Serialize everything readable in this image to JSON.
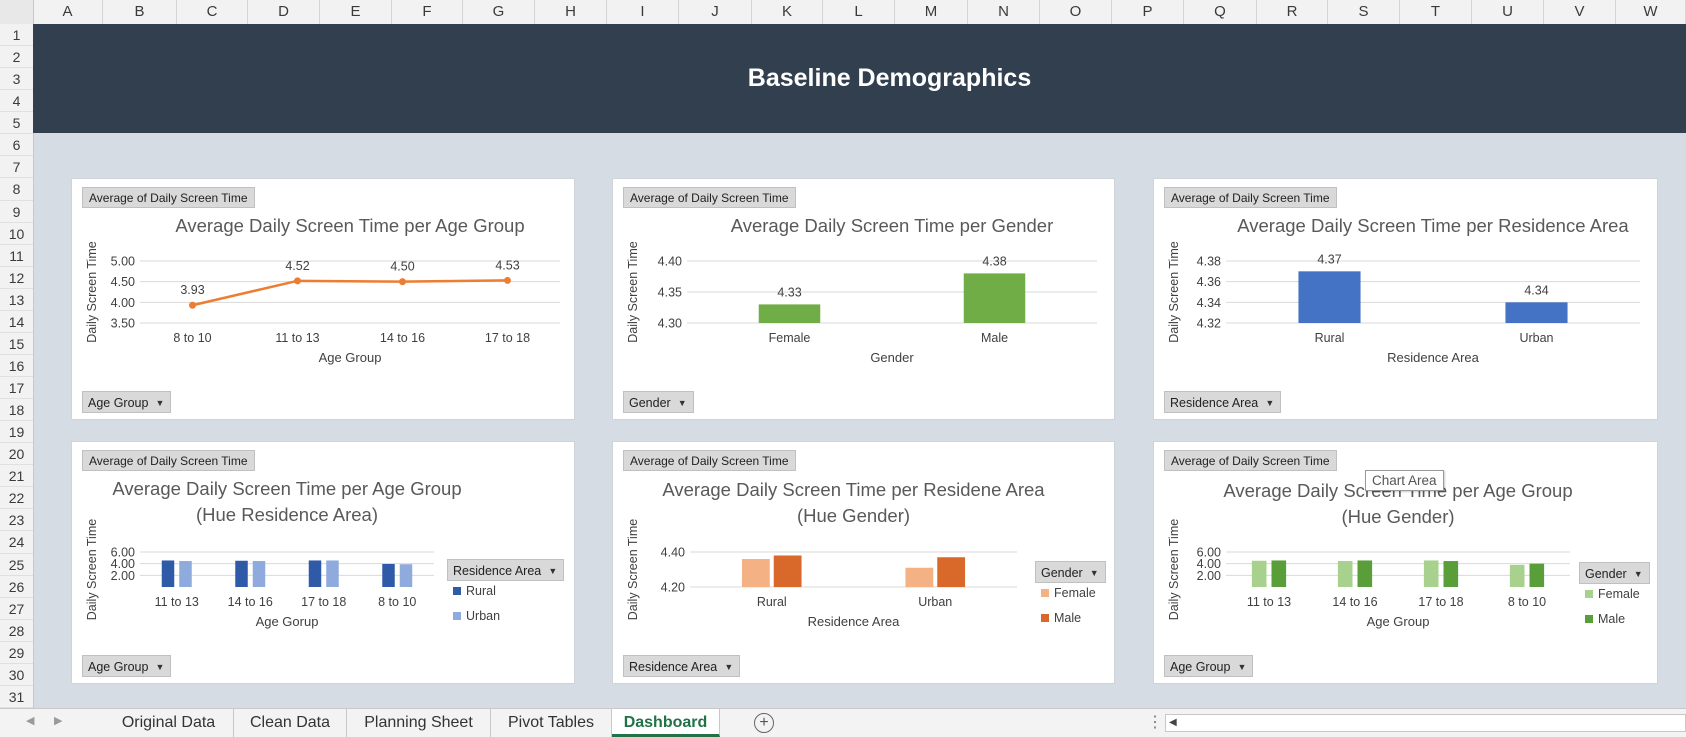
{
  "columns": [
    "A",
    "B",
    "C",
    "D",
    "E",
    "F",
    "G",
    "H",
    "I",
    "J",
    "K",
    "L",
    "M",
    "N",
    "O",
    "P",
    "Q",
    "R",
    "S",
    "T",
    "U",
    "V",
    "W"
  ],
  "rows": [
    "1",
    "2",
    "3",
    "4",
    "5",
    "6",
    "7",
    "8",
    "9",
    "10",
    "11",
    "12",
    "13",
    "14",
    "15",
    "16",
    "17",
    "18",
    "19",
    "20",
    "21",
    "22",
    "23",
    "24",
    "25",
    "26",
    "27",
    "28",
    "29",
    "30",
    "31"
  ],
  "banner": {
    "title": "Baseline Demographics"
  },
  "tooltip": "Chart Area",
  "charts": [
    {
      "value_field": "Average of Daily Screen Time",
      "filter_field": "Age Group",
      "chart_data": {
        "type": "line",
        "title": "Average Daily Screen Time per Age Group",
        "xlabel": "Age Group",
        "ylabel": "Daily Screen Time",
        "categories": [
          "8 to 10",
          "11 to 13",
          "14 to 16",
          "17 to 18"
        ],
        "series": [
          {
            "values": [
              3.93,
              4.52,
              4.5,
              4.53
            ],
            "color": "#ed7d31"
          }
        ],
        "value_labels": [
          "3.93",
          "4.52",
          "4.50",
          "4.53"
        ],
        "yticks": [
          "3.50",
          "4.00",
          "4.50",
          "5.00"
        ],
        "ylim": [
          3.5,
          5.0
        ]
      }
    },
    {
      "value_field": "Average of Daily Screen Time",
      "filter_field": "Gender",
      "chart_data": {
        "type": "bar",
        "title": "Average Daily Screen Time per Gender",
        "xlabel": "Gender",
        "ylabel": "Daily Screen Time",
        "categories": [
          "Female",
          "Male"
        ],
        "series": [
          {
            "values": [
              4.33,
              4.38
            ],
            "color": "#70ad47"
          }
        ],
        "value_labels": [
          "4.33",
          "4.38"
        ],
        "yticks": [
          "4.30",
          "4.35",
          "4.40"
        ],
        "ylim": [
          4.3,
          4.4
        ]
      }
    },
    {
      "value_field": "Average of Daily Screen Time",
      "filter_field": "Residence Area",
      "chart_data": {
        "type": "bar",
        "title": "Average Daily Screen Time per Residence Area",
        "xlabel": "Residence Area",
        "ylabel": "Daily Screen Time",
        "categories": [
          "Rural",
          "Urban"
        ],
        "series": [
          {
            "values": [
              4.37,
              4.34
            ],
            "color": "#4472c4"
          }
        ],
        "value_labels": [
          "4.37",
          "4.34"
        ],
        "yticks": [
          "4.32",
          "4.34",
          "4.36",
          "4.38"
        ],
        "ylim": [
          4.32,
          4.38
        ]
      }
    },
    {
      "value_field": "Average of Daily Screen Time",
      "filter_field": "Age Group",
      "legend_field": "Residence Area",
      "chart_data": {
        "type": "bar",
        "title": "Average Daily Screen Time per Age Group",
        "subtitle": "(Hue Residence Area)",
        "xlabel": "Age Gorup",
        "ylabel": "Daily Screen Time",
        "categories": [
          "11 to 13",
          "14 to 16",
          "17 to 18",
          "8 to 10"
        ],
        "series": [
          {
            "name": "Rural",
            "values": [
              4.55,
              4.5,
              4.55,
              3.95
            ],
            "color": "#2f5aa8"
          },
          {
            "name": "Urban",
            "values": [
              4.45,
              4.45,
              4.55,
              3.9
            ],
            "color": "#8faadc"
          }
        ],
        "yticks": [
          "2.00",
          "4.00",
          "6.00"
        ],
        "ylim": [
          0,
          6.0
        ],
        "legend": "right"
      }
    },
    {
      "value_field": "Average of Daily Screen Time",
      "filter_field": "Residence Area",
      "legend_field": "Gender",
      "chart_data": {
        "type": "bar",
        "title": "Average Daily Screen Time per Residene Area",
        "subtitle": "(Hue Gender)",
        "xlabel": "Residence Area",
        "ylabel": "Daily Screen Time",
        "categories": [
          "Rural",
          "Urban"
        ],
        "series": [
          {
            "name": "Female",
            "values": [
              4.36,
              4.31
            ],
            "color": "#f4b183"
          },
          {
            "name": "Male",
            "values": [
              4.38,
              4.37
            ],
            "color": "#d9692a"
          }
        ],
        "yticks": [
          "4.20",
          "4.40"
        ],
        "ylim": [
          4.2,
          4.4
        ],
        "legend": "right"
      }
    },
    {
      "value_field": "Average of Daily Screen Time",
      "filter_field": "Age Group",
      "legend_field": "Gender",
      "chart_data": {
        "type": "bar",
        "title": "Average Daily Screen Time per Age Group",
        "subtitle": "(Hue Gender)",
        "xlabel": "Age Group",
        "ylabel": "Daily Screen Time",
        "categories": [
          "11 to 13",
          "14 to 16",
          "17 to 18",
          "8 to 10"
        ],
        "series": [
          {
            "name": "Female",
            "values": [
              4.5,
              4.45,
              4.55,
              3.8
            ],
            "color": "#a9d18e"
          },
          {
            "name": "Male",
            "values": [
              4.55,
              4.55,
              4.45,
              4.0
            ],
            "color": "#5a9e3a"
          }
        ],
        "yticks": [
          "2.00",
          "4.00",
          "6.00"
        ],
        "ylim": [
          0,
          6.0
        ],
        "legend": "right"
      }
    }
  ],
  "sheet_tabs": [
    "Original Data",
    "Clean Data",
    "Planning Sheet",
    "Pivot Tables",
    "Dashboard"
  ],
  "active_tab": "Dashboard"
}
